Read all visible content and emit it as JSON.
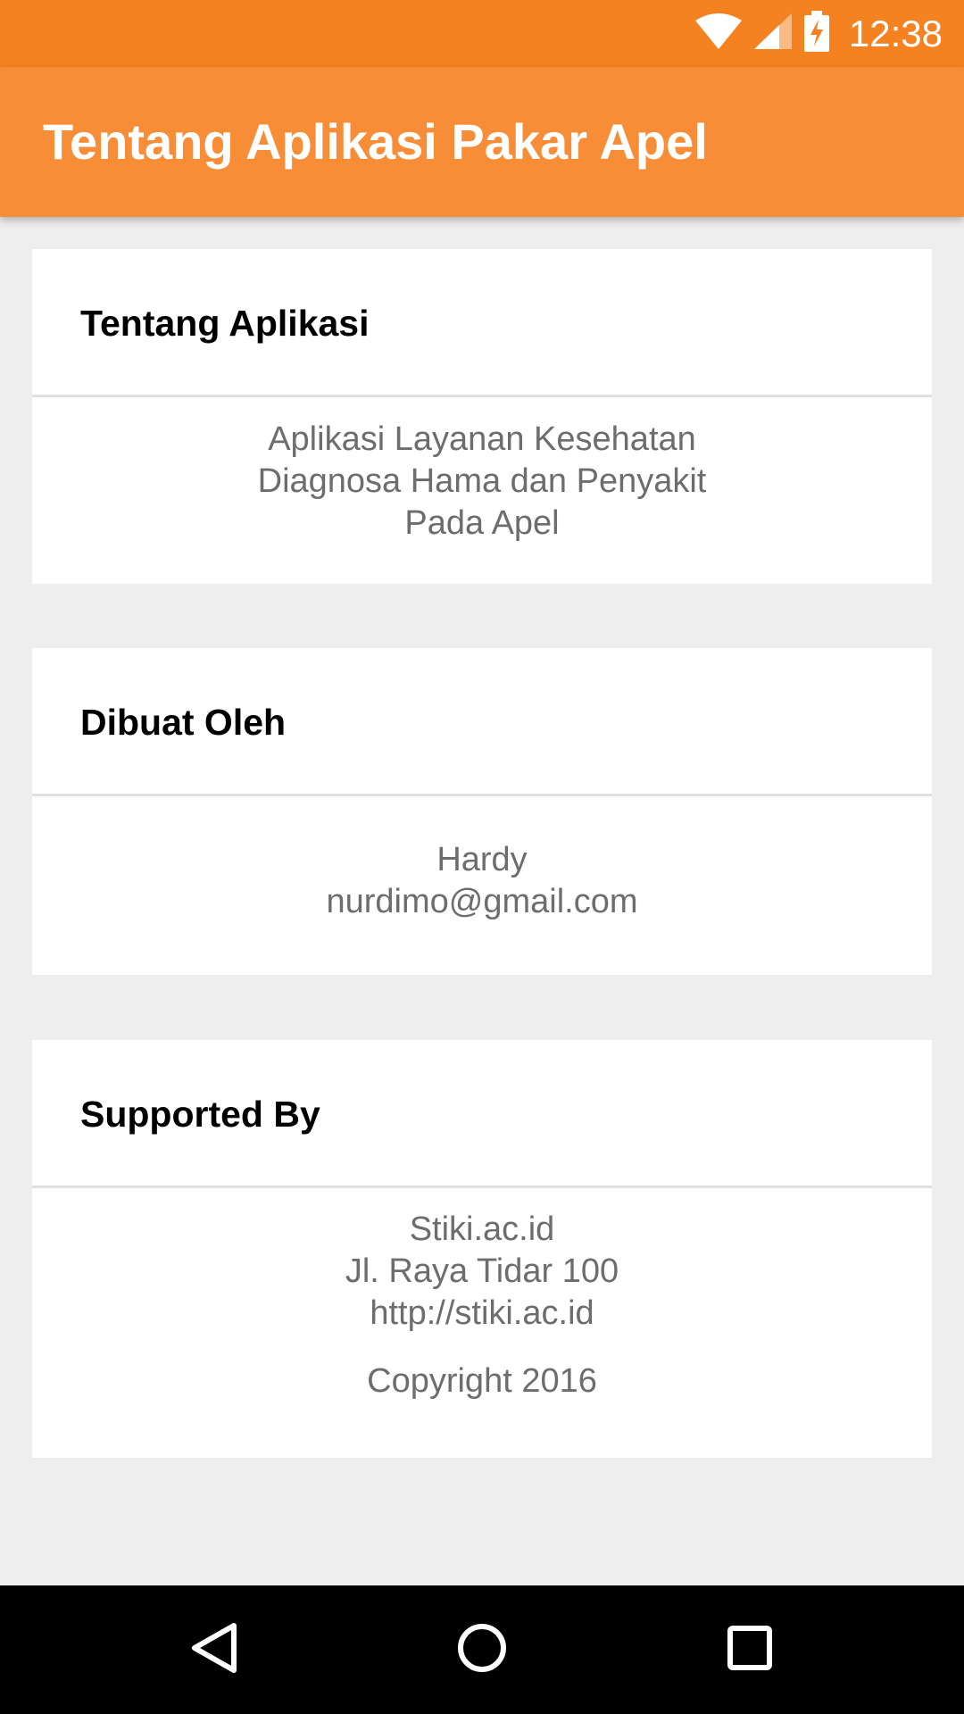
{
  "status_bar": {
    "time": "12:38",
    "icons": [
      "wifi-icon",
      "cell-signal-icon",
      "battery-charging-icon"
    ]
  },
  "app_bar": {
    "title": "Tentang Aplikasi Pakar Apel"
  },
  "cards": [
    {
      "title": "Tentang Aplikasi",
      "lines": [
        "Aplikasi Layanan Kesehatan",
        "Diagnosa Hama dan Penyakit",
        "Pada Apel"
      ]
    },
    {
      "title": "Dibuat Oleh",
      "lines": [
        "Hardy",
        "nurdimo@gmail.com"
      ]
    },
    {
      "title": "Supported By",
      "lines": [
        "Stiki.ac.id",
        "Jl. Raya Tidar 100",
        "http://stiki.ac.id",
        "Copyright 2016"
      ]
    }
  ],
  "nav_bar": {
    "buttons": [
      "back-icon",
      "home-icon",
      "recents-icon"
    ]
  },
  "colors": {
    "status_bar": "#f58220",
    "app_bar": "#f78d37",
    "background": "#eeeeee",
    "card": "#ffffff",
    "body_text": "#6d6d6d"
  }
}
